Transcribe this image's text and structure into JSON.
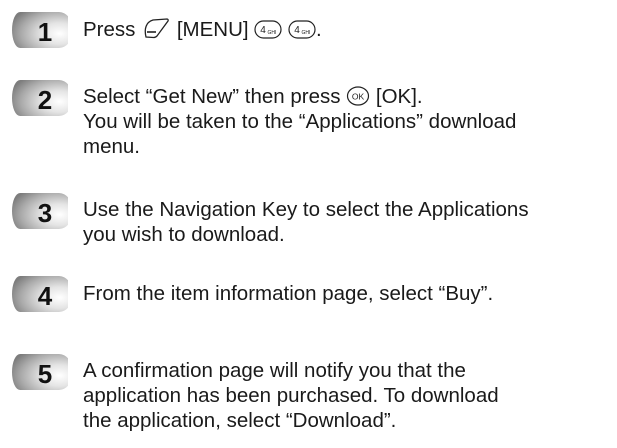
{
  "steps": [
    {
      "number": "1",
      "text": {
        "prefix": "Press",
        "menu_label": "[MENU]",
        "key_digit_a": "4",
        "key_sub_a": "GHI",
        "key_digit_b": "4",
        "key_sub_b": "GHI",
        "suffix": "."
      },
      "icons": [
        "soft-key-icon",
        "key-4-ghi-icon",
        "key-4-ghi-icon"
      ]
    },
    {
      "number": "2",
      "text": {
        "line1_prefix": "Select “Get New” then press",
        "ok_key_label": "OK",
        "ok_label": "[OK].",
        "line2": "You will be taken to the “Applications” download",
        "line3": "menu."
      },
      "icons": [
        "ok-key-icon"
      ]
    },
    {
      "number": "3",
      "text": {
        "line1": "Use the Navigation Key to select the Applications",
        "line2": "you wish to download."
      }
    },
    {
      "number": "4",
      "text": {
        "line1": "From the item information page, select “Buy”."
      }
    },
    {
      "number": "5",
      "text": {
        "line1": "A confirmation page will notify you that the",
        "line2": "application has been purchased. To download",
        "line3": "the application, select “Download”."
      }
    }
  ],
  "colors": {
    "badge_dark": "#8c8c8c",
    "badge_light": "#f2f2f2",
    "number": "#111111",
    "text": "#1a1a1a"
  }
}
